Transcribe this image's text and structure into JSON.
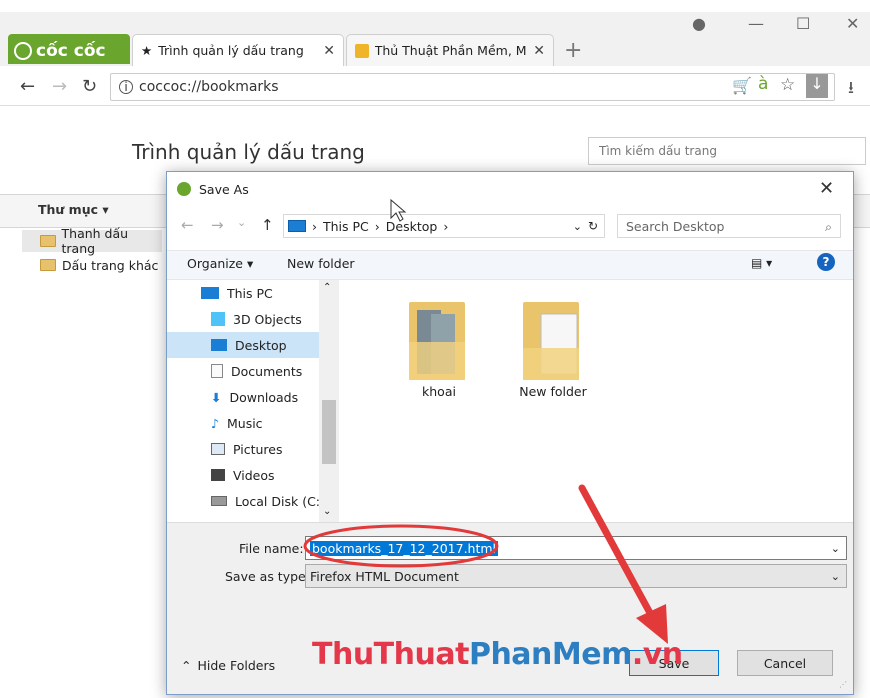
{
  "browser": {
    "logo": "cốc cốc",
    "tabs": [
      {
        "label": "Trình quản lý dấu trang",
        "close": "✕"
      },
      {
        "label": "Thủ Thuật Phần Mềm, Mẹ",
        "close": "✕"
      }
    ],
    "new_tab": "+",
    "url": "coccoc://bookmarks"
  },
  "bookmarks": {
    "title": "Trình quản lý dấu trang",
    "search_placeholder": "Tìm kiếm dấu trang",
    "folders_label": "Thư mục ▾",
    "items": [
      "Thanh dấu trang",
      "Dấu trang khác"
    ]
  },
  "dialog": {
    "title": "Save As",
    "path": [
      "This PC",
      "Desktop"
    ],
    "search_placeholder": "Search Desktop",
    "organize": "Organize ▾",
    "new_folder": "New folder",
    "tree": [
      "This PC",
      "3D Objects",
      "Desktop",
      "Documents",
      "Downloads",
      "Music",
      "Pictures",
      "Videos",
      "Local Disk (C:)"
    ],
    "files": [
      "khoai",
      "New folder"
    ],
    "file_name_label": "File name:",
    "file_name_value": "bookmarks_17_12_2017.html",
    "save_type_label": "Save as type:",
    "save_type_value": "Firefox HTML Document",
    "hide_folders": "Hide Folders",
    "save_button": "Save",
    "cancel_button": "Cancel"
  },
  "watermark": {
    "part1": "ThuThuat",
    "part2": "PhanMem",
    "part3": ".vn"
  },
  "colors": {
    "brand_green": "#6aa52e",
    "selection": "#0078d7",
    "annotation_red": "#e23a3a"
  }
}
